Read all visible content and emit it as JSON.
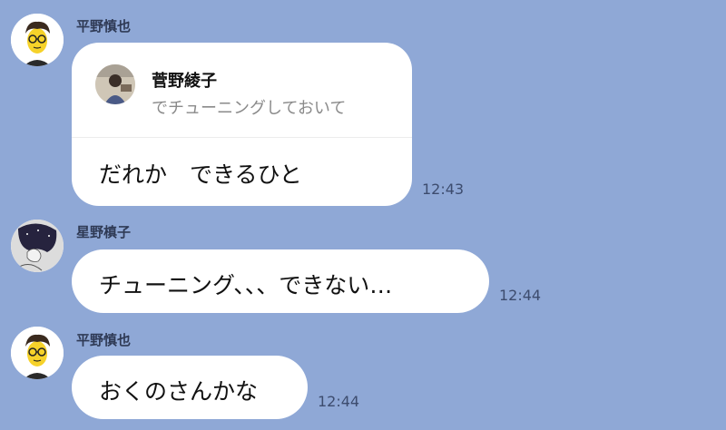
{
  "messages": [
    {
      "sender": "平野慎也",
      "reply": {
        "name": "菅野綾子",
        "snippet": "でチューニングしておいて"
      },
      "text": "だれか　できるひと",
      "time": "12:43"
    },
    {
      "sender": "星野槙子",
      "text": "チューニング、、、できない…",
      "time": "12:44"
    },
    {
      "sender": "平野慎也",
      "text": "おくのさんかな",
      "time": "12:44"
    }
  ],
  "colors": {
    "background": "#8fa8d6",
    "bubble": "#ffffff",
    "sender_text": "#2f3a55",
    "time_text": "#3d4c6e",
    "snippet_text": "#8a8a8a"
  },
  "icons": {
    "avatar_1": "cartoon-face-avatar-icon",
    "avatar_2": "sketch-portrait-avatar-icon",
    "reply_avatar": "photo-avatar-icon"
  }
}
